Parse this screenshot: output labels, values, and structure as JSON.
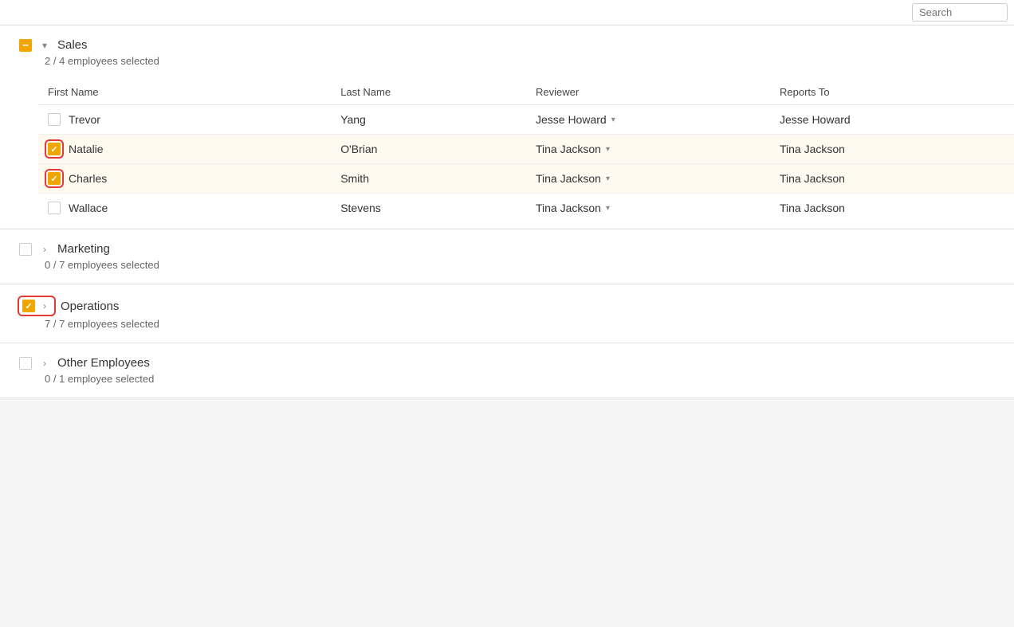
{
  "topbar": {
    "search_placeholder": "Search"
  },
  "sections": [
    {
      "id": "sales",
      "title": "Sales",
      "subtitle": "2 / 4 employees selected",
      "checkbox_state": "indeterminate",
      "expanded": true,
      "highlight_checkbox": false,
      "columns": [
        "First Name",
        "Last Name",
        "Reviewer",
        "Reports To"
      ],
      "employees": [
        {
          "first_name": "Trevor",
          "last_name": "Yang",
          "reviewer": "Jesse Howard",
          "reports_to": "Jesse Howard",
          "checked": false,
          "highlight": false
        },
        {
          "first_name": "Natalie",
          "last_name": "O'Brian",
          "reviewer": "Tina Jackson",
          "reports_to": "Tina Jackson",
          "checked": true,
          "highlight": true
        },
        {
          "first_name": "Charles",
          "last_name": "Smith",
          "reviewer": "Tina Jackson",
          "reports_to": "Tina Jackson",
          "checked": true,
          "highlight": true
        },
        {
          "first_name": "Wallace",
          "last_name": "Stevens",
          "reviewer": "Tina Jackson",
          "reports_to": "Tina Jackson",
          "checked": false,
          "highlight": false
        }
      ]
    },
    {
      "id": "marketing",
      "title": "Marketing",
      "subtitle": "0 / 7 employees selected",
      "checkbox_state": "unchecked",
      "expanded": false,
      "highlight_checkbox": false
    },
    {
      "id": "operations",
      "title": "Operations",
      "subtitle": "7 / 7 employees selected",
      "checkbox_state": "checked",
      "expanded": false,
      "highlight_checkbox": true
    },
    {
      "id": "other",
      "title": "Other Employees",
      "subtitle": "0 / 1 employee selected",
      "checkbox_state": "unchecked",
      "expanded": false,
      "highlight_checkbox": false
    }
  ]
}
